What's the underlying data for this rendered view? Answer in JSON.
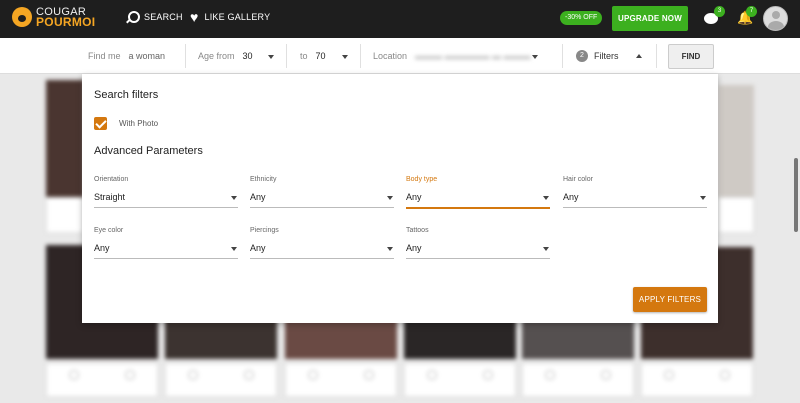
{
  "header": {
    "logo_line1": "COUGAR",
    "logo_line2": "POURMOI",
    "nav_search": "SEARCH",
    "nav_like_gallery": "LIKE GALLERY",
    "discount_badge": "-30% OFF",
    "upgrade_label": "UPGRADE NOW",
    "messages_count": "3",
    "notifications_count": "7"
  },
  "searchbar": {
    "find_me_label": "Find me",
    "find_me_value": "a woman",
    "age_from_label": "Age from",
    "age_from_value": "30",
    "age_to_label": "to",
    "age_to_value": "70",
    "location_label": "Location",
    "filters_count": "2",
    "filters_label": "Filters",
    "find_label": "FIND"
  },
  "filters_panel": {
    "title": "Search filters",
    "with_photo_label": "With Photo",
    "with_photo_checked": true,
    "advanced_title": "Advanced Parameters",
    "fields": [
      {
        "label": "Orientation",
        "value": "Straight"
      },
      {
        "label": "Ethnicity",
        "value": "Any"
      },
      {
        "label": "Body type",
        "value": "Any"
      },
      {
        "label": "Hair color",
        "value": "Any"
      },
      {
        "label": "Eye color",
        "value": "Any"
      },
      {
        "label": "Piercings",
        "value": "Any"
      },
      {
        "label": "Tattoos",
        "value": "Any"
      }
    ],
    "apply_label": "APPLY FILTERS"
  },
  "colors": {
    "accent_orange": "#d4780f",
    "upgrade_green": "#3cb01f",
    "topbar_bg": "#1e1e1e"
  }
}
